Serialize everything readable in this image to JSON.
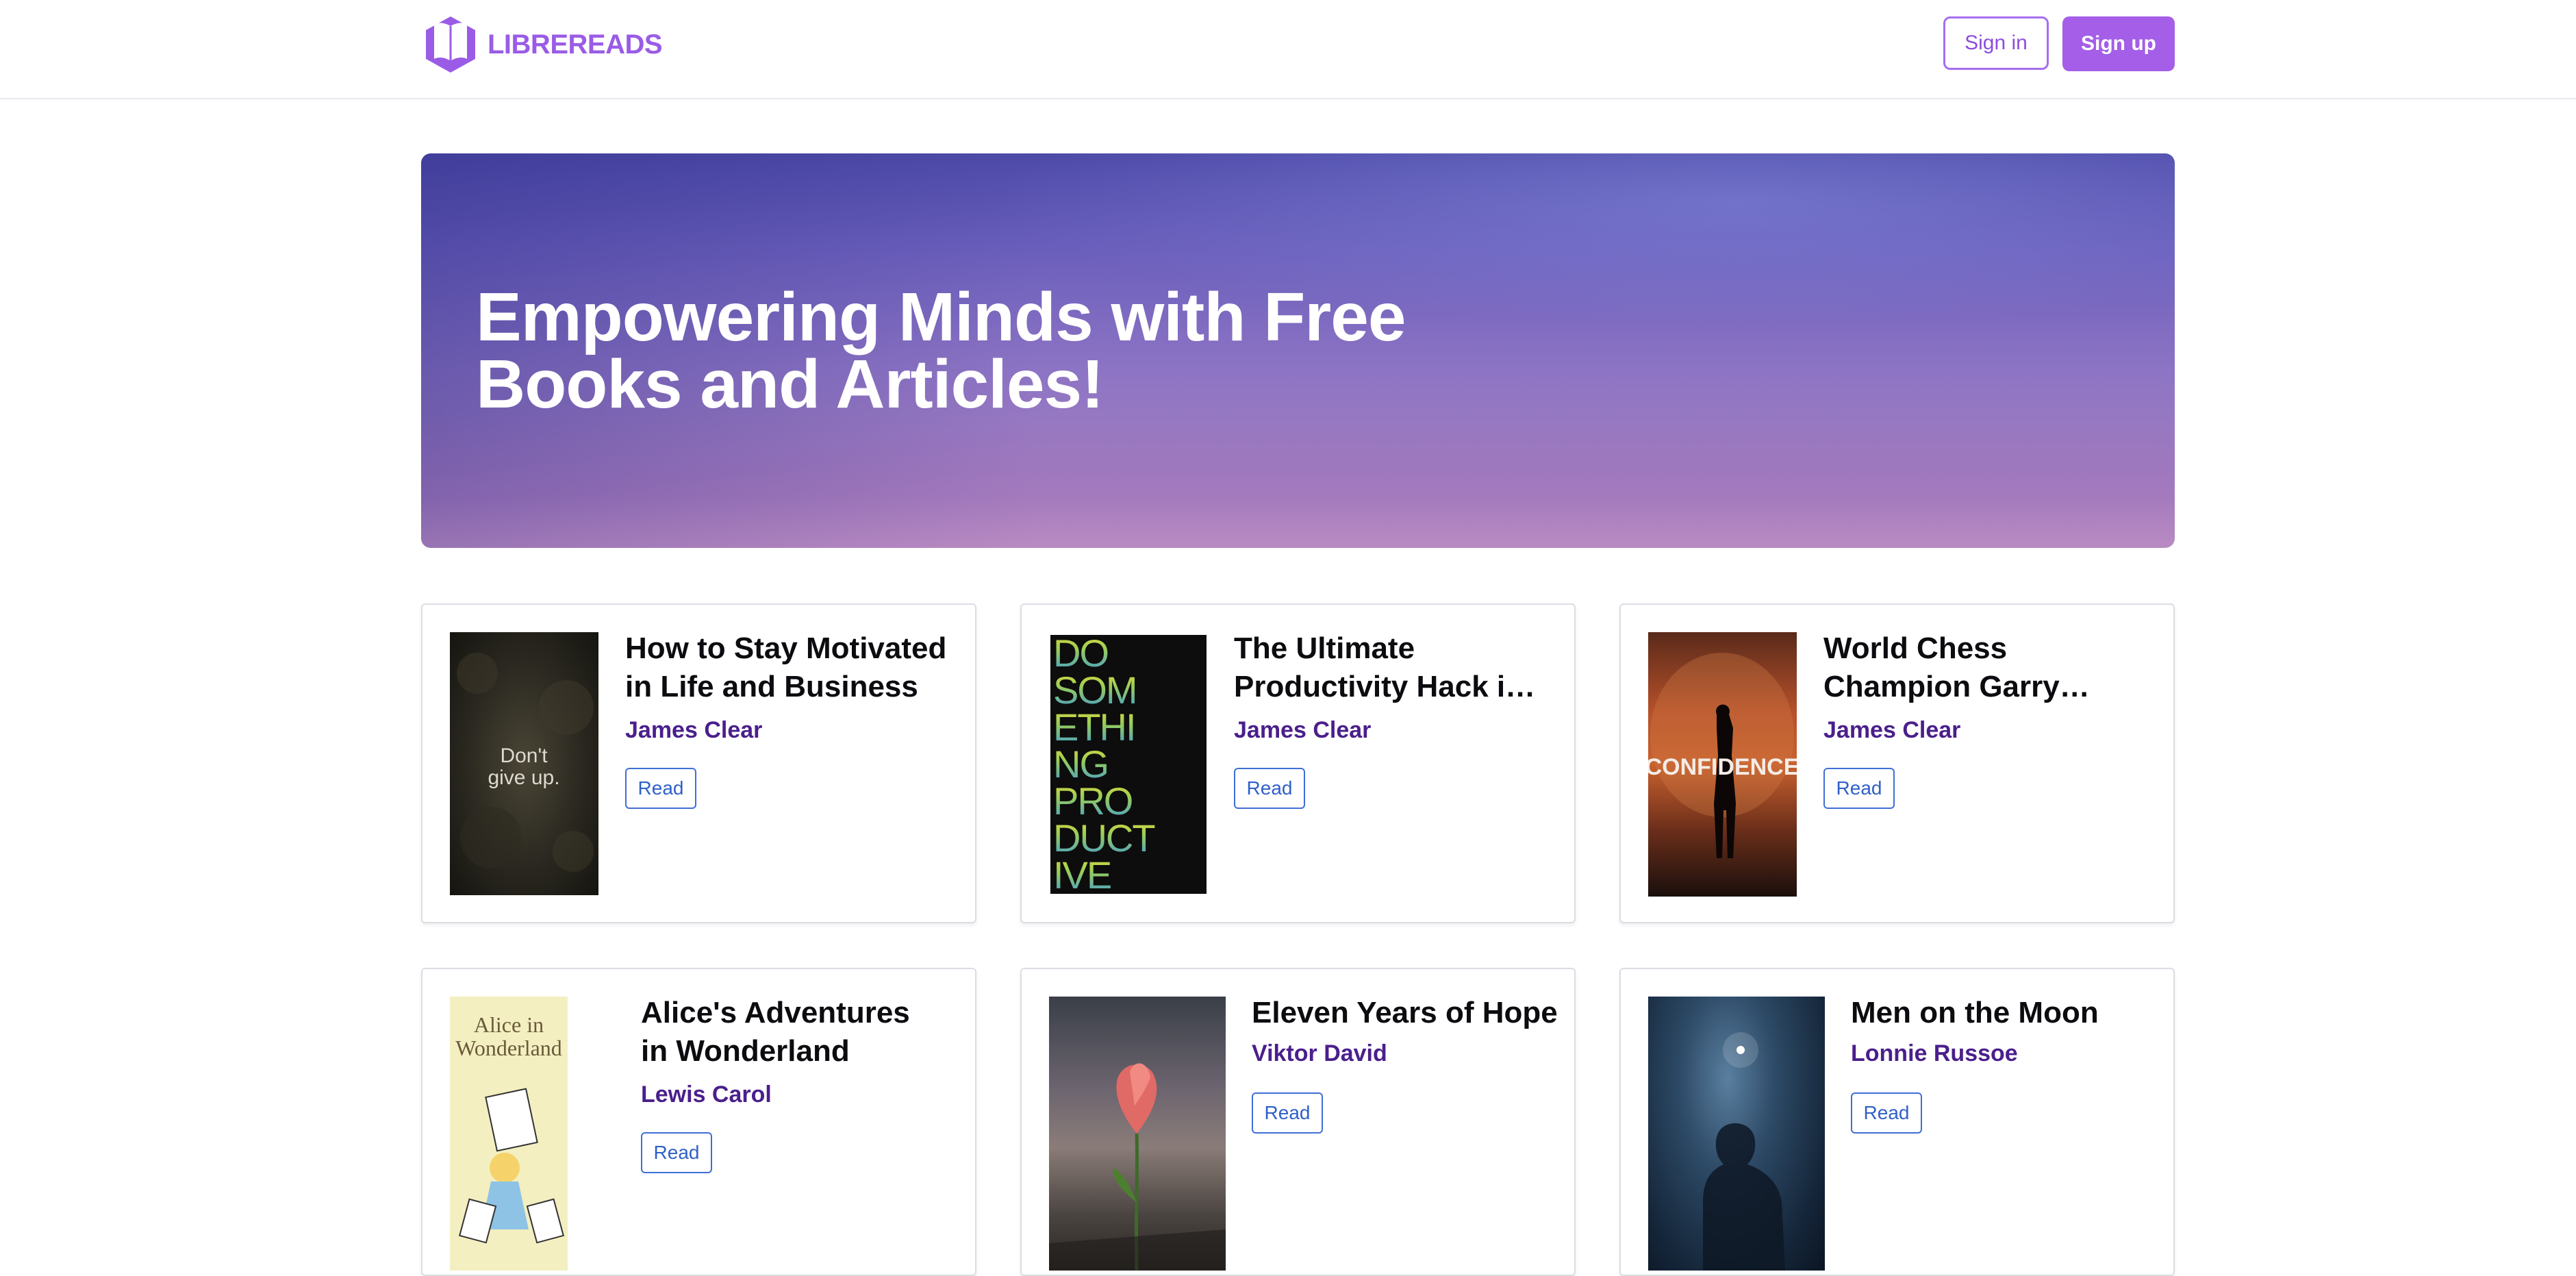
{
  "brand": {
    "name": "LIBREREADS",
    "logo_icon": "book-hexagon-icon",
    "color": "#9a5ce6"
  },
  "header": {
    "signin_label": "Sign in",
    "signup_label": "Sign up"
  },
  "hero": {
    "title": "Empowering Minds with Free Books and Articles!"
  },
  "books": [
    {
      "title": "How to Stay Motivated in Life and Business",
      "author": "James Clear",
      "read_label": "Read",
      "cover_text": "Don't give up."
    },
    {
      "title": "The Ultimate Productivity Hack is Saying No",
      "author": "James Clear",
      "read_label": "Read",
      "cover_text": "DO SOM ETHI NG PRO DUCT IVE"
    },
    {
      "title": "World Chess Champion Garry Kasparov on How to Improve",
      "author": "James Clear",
      "read_label": "Read",
      "cover_text": "CONFIDENCE"
    },
    {
      "title": "Alice's Adventures in Wonderland",
      "author": "Lewis Carol",
      "read_label": "Read",
      "cover_text": "Alice in Wonderland"
    },
    {
      "title": "Eleven Years of Hope",
      "author": "Viktor David",
      "read_label": "Read",
      "cover_text": ""
    },
    {
      "title": "Men on the Moon",
      "author": "Lonnie Russoe",
      "read_label": "Read",
      "cover_text": ""
    }
  ],
  "colors": {
    "accent": "#a45ee8",
    "author": "#4a1f8c",
    "read_button": "#2f60c8"
  }
}
